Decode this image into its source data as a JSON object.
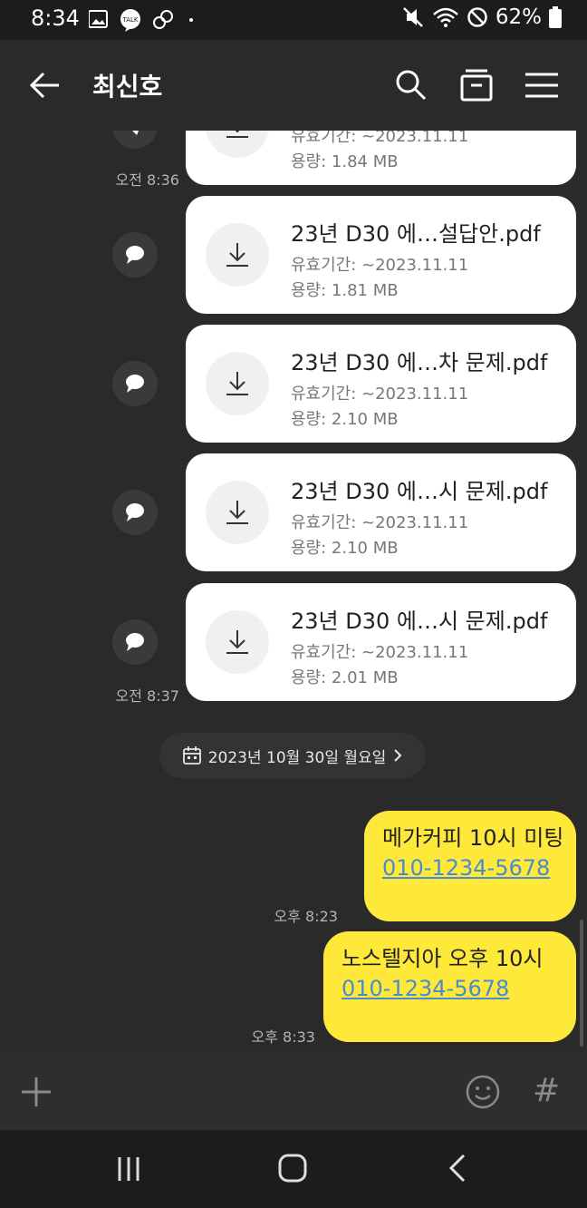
{
  "status_bar": {
    "time": "8:34",
    "battery": "62%",
    "notification_label": "TALK"
  },
  "header": {
    "title": "최신호"
  },
  "messages": {
    "files": [
      {
        "name": "",
        "expiry": "유효기간: ~2023.11.11",
        "size": "용량: 1.84 MB"
      },
      {
        "name": "23년 D30 에…설답안.pdf",
        "expiry": "유효기간: ~2023.11.11",
        "size": "용량: 1.81 MB"
      },
      {
        "name": "23년 D30 에…차 문제.pdf",
        "expiry": "유효기간: ~2023.11.11",
        "size": "용량: 2.10 MB"
      },
      {
        "name": "23년 D30 에…시 문제.pdf",
        "expiry": "유효기간: ~2023.11.11",
        "size": "용량: 2.10 MB"
      },
      {
        "name": "23년 D30 에…시 문제.pdf",
        "expiry": "유효기간: ~2023.11.11",
        "size": "용량: 2.01 MB"
      }
    ],
    "times": {
      "t1": "오전 8:36",
      "t2": "오전 8:37"
    },
    "date_divider": "2023년 10월 30일 월요일",
    "sent": [
      {
        "text": "메가커피 10시 미팅",
        "phone": "010-1234-5678",
        "time": "오후 8:23"
      },
      {
        "text": "노스텔지아 오후 10시",
        "phone": "010-1234-5678",
        "time": "오후 8:33"
      }
    ]
  },
  "input_bar": {
    "add_icon": "plus-icon",
    "emoji_icon": "smile-icon",
    "hashtag": "#"
  },
  "colors": {
    "bubble": "#fee93b",
    "background": "#2a2a2b",
    "link": "#4a8ad0"
  }
}
